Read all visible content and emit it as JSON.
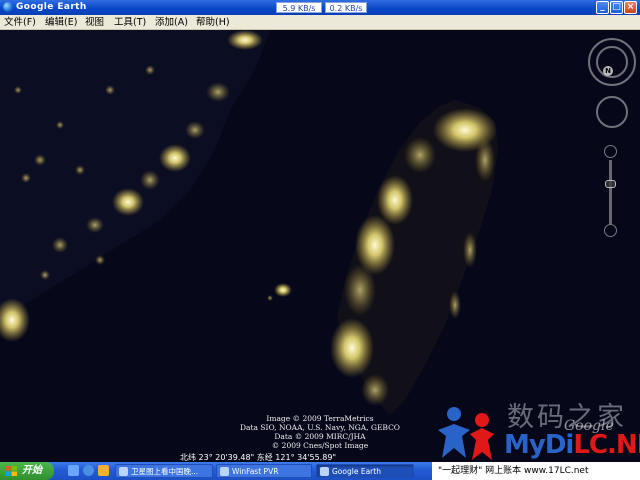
{
  "window": {
    "title": "Google Earth",
    "download_speed": "5.9 KB/s",
    "upload_speed": "0.2 KB/s",
    "controls": {
      "minimize": "_",
      "maximize": "□",
      "close": "×"
    }
  },
  "menu": {
    "items": [
      "文件(F)",
      "编辑(E)",
      "视图",
      "工具(T)",
      "添加(A)",
      "帮助(H)"
    ]
  },
  "map": {
    "attribution": [
      "Image © 2009 TerraMetrics",
      "Data SIO, NOAA, U.S. Navy, NGA, GEBCO",
      "Data © 2009 MIRC/JHA",
      "© 2009 Cnes/Spot Image"
    ],
    "coordinates": "北纬 23° 20'39.48\"   东经 121° 34'55.89\"",
    "compass_label": "N"
  },
  "watermark": {
    "title": "数码之家",
    "brand_blue": "MyDi",
    "brand_red": "LC",
    "brand_blue2": ".NET",
    "google": "Google"
  },
  "taskbar": {
    "start_label": "开始",
    "tasks": [
      "卫星图上看中国晚...",
      "WinFast PVR",
      "Google Earth"
    ],
    "tray_text": "\"一起理财\" 网上账本 www.17LC.net"
  },
  "colors": {
    "titlebar": "#0a46c8",
    "menubar": "#ece9d8",
    "city_lights": "#fff4a0",
    "ocean": "#06081a"
  }
}
